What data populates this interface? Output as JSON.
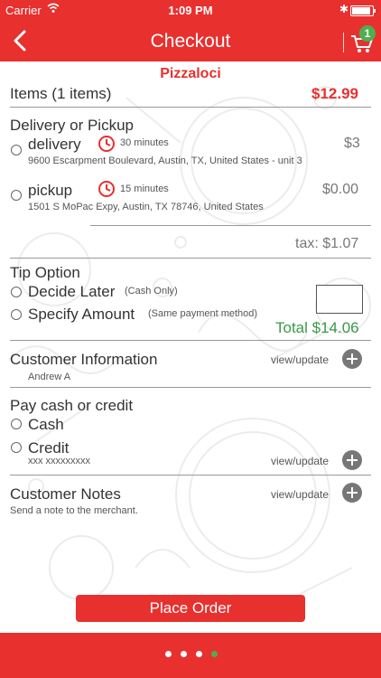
{
  "status_bar": {
    "carrier": "Carrier",
    "time": "1:09 PM"
  },
  "nav": {
    "title": "Checkout",
    "cart_count": "1"
  },
  "merchant": "Pizzaloci",
  "items": {
    "label": "Items (1 items)",
    "total": "$12.99"
  },
  "delivery_pickup": {
    "title": "Delivery or Pickup",
    "options": [
      {
        "label": "delivery",
        "time": "30 minutes",
        "fee": "$3",
        "address": "9600 Escarpment Boulevard, Austin, TX, United States - unit 3"
      },
      {
        "label": "pickup",
        "time": "15 minutes",
        "fee": "$0.00",
        "address": "1501 S MoPac Expy, Austin, TX 78746, United States"
      }
    ]
  },
  "tax": "tax: $1.07",
  "tip": {
    "title": "Tip Option",
    "options": [
      {
        "label": "Decide Later",
        "note": "(Cash Only)"
      },
      {
        "label": "Specify Amount",
        "note": "(Same payment method)"
      }
    ],
    "input_value": ""
  },
  "total": "Total $14.06",
  "customer_info": {
    "title": "Customer Information",
    "link": "view/update",
    "name": "Andrew A"
  },
  "payment": {
    "title": "Pay cash or credit",
    "options": [
      {
        "label": "Cash"
      },
      {
        "label": "Credit"
      }
    ],
    "card": "xxx xxxxxxxxx",
    "link": "view/update"
  },
  "notes": {
    "title": "Customer Notes",
    "link": "view/update",
    "placeholder": "Send a note to the merchant."
  },
  "place_order": "Place Order",
  "page_indicator": {
    "count": 4,
    "active_index": 3
  },
  "colors": {
    "brand_red": "#e8302f",
    "total_green": "#3a9a47",
    "indicator_green": "#4caf50",
    "divider": "#999999"
  },
  "icons": [
    "back-chevron-icon",
    "cart-icon",
    "clock-icon",
    "plus-circle-icon",
    "wifi-icon",
    "bluetooth-icon",
    "battery-icon"
  ]
}
